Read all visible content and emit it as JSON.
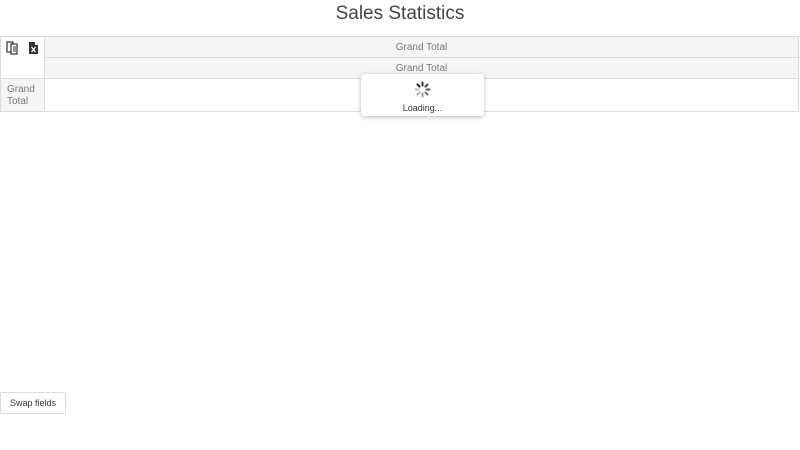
{
  "page": {
    "title": "Sales Statistics"
  },
  "pivot_grid": {
    "column_headers": [
      "Grand Total",
      "Grand Total"
    ],
    "row_header": "Grand Total",
    "toolbar": {
      "field_chooser_icon": "field-chooser-icon",
      "export_icon": "excel-export-icon"
    }
  },
  "load_panel": {
    "text": "Loading..."
  },
  "actions": {
    "swap_label": "Swap fields"
  },
  "colors": {
    "border": "#dcdcdc",
    "header_bg": "#f5f5f5",
    "header_text": "#777777"
  }
}
